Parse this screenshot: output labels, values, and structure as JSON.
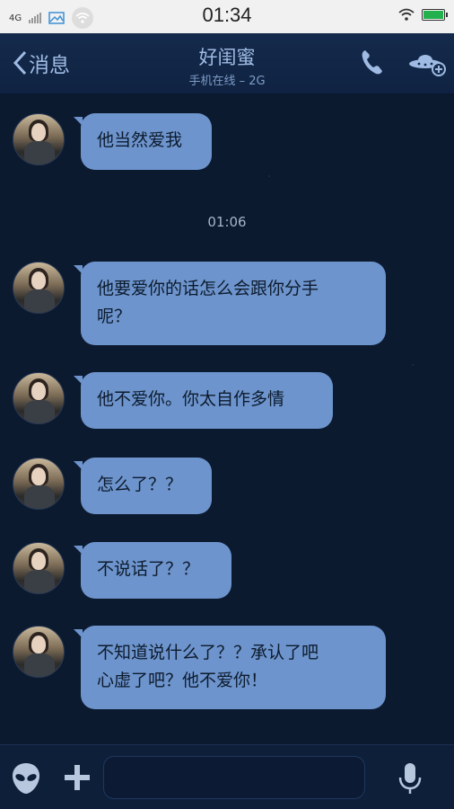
{
  "status_bar": {
    "network": "4G",
    "time": "01:34",
    "battery_level": 1.0
  },
  "header": {
    "back_label": "消息",
    "title": "好闺蜜",
    "subtitle": "手机在线 – 2G"
  },
  "messages": [
    {
      "lines": [
        "他当然爱我"
      ]
    },
    {
      "lines": [
        "他要爱你的话怎么会跟你分手",
        "呢？"
      ]
    },
    {
      "lines": [
        "他不爱你。你太自作多情"
      ]
    },
    {
      "lines": [
        "怎么了？？"
      ]
    },
    {
      "lines": [
        "不说话了？？"
      ]
    },
    {
      "lines": [
        "不知道说什么了？？承认了吧",
        "心虚了吧？他不爱你！"
      ]
    }
  ],
  "time_divider": "01:06",
  "input": {
    "value": "",
    "placeholder": ""
  },
  "colors": {
    "bubble": "#6d94cc",
    "header_bg": "#152b4c",
    "chat_bg": "#0c1a30",
    "accent_text": "#9fbbe3"
  },
  "icons": {
    "back": "chevron-left-icon",
    "call": "phone-icon",
    "ufo": "ufo-add-icon",
    "alien": "alien-emoji-icon",
    "plus": "plus-icon",
    "mic": "microphone-icon"
  }
}
